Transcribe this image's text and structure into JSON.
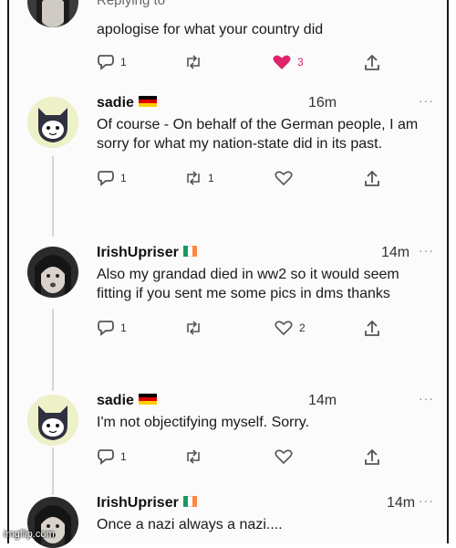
{
  "top_tweet": {
    "replying_label": "Replying to",
    "text": "apologise for what your country did",
    "reply_count": "1",
    "like_count": "3"
  },
  "tweets": [
    {
      "name": "sadie",
      "flag": "germany",
      "time": "16m",
      "text": "Of course - On behalf of the German people, I am sorry for what my nation-state did in its past.",
      "reply_count": "1",
      "retweet_count": "1",
      "like_count": ""
    },
    {
      "name": "IrishUpriser",
      "flag": "ireland",
      "time": "14m",
      "text": "Also my grandad died in ww2 so it would seem fitting if you sent me some pics in dms thanks",
      "reply_count": "1",
      "retweet_count": "",
      "like_count": "2"
    },
    {
      "name": "sadie",
      "flag": "germany",
      "time": "14m",
      "text": "I'm not objectifying myself. Sorry.",
      "reply_count": "1",
      "retweet_count": "",
      "like_count": ""
    },
    {
      "name": "IrishUpriser",
      "flag": "ireland",
      "time": "14m",
      "text": "Once a nazi always a nazi....",
      "reply_count": "",
      "retweet_count": "",
      "like_count": ""
    }
  ],
  "more_label": "···",
  "watermark": "imgflip.com",
  "colors": {
    "like_active": "#e0246b",
    "icon_gray": "#555555",
    "thread_line": "#d4d4d4"
  }
}
